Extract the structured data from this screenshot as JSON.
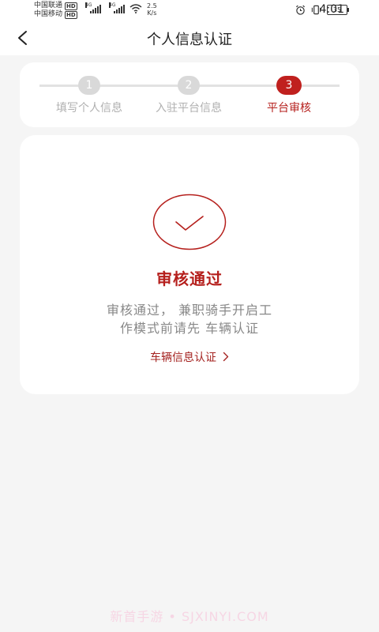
{
  "status_bar": {
    "carrier1": "中国联通",
    "carrier2": "中国移动",
    "hd1": "HD",
    "hd2": "HD",
    "net1": "4G",
    "net2": "4G",
    "speed_value": "2.5",
    "speed_unit": "K/s",
    "battery": "35",
    "time": "4:01",
    "icons": [
      "signal-icon",
      "wifi-icon",
      "alarm-icon",
      "vibrate-icon",
      "battery-icon"
    ]
  },
  "header": {
    "title": "个人信息认证",
    "back_icon": "chevron-left-icon"
  },
  "steps": [
    {
      "number": "1",
      "label": "填写个人信息",
      "active": false
    },
    {
      "number": "2",
      "label": "入驻平台信息",
      "active": false
    },
    {
      "number": "3",
      "label": "平台审核",
      "active": true
    }
  ],
  "result": {
    "icon": "check-circle-icon",
    "title": "审核通过",
    "desc_line1": "审核通过， 兼职骑手开启工",
    "desc_line2": "作模式前请先 车辆认证",
    "link_label": "车辆信息认证",
    "link_icon": "chevron-right-icon"
  },
  "watermark": "新首手游 • SJXINYI.COM",
  "colors": {
    "accent": "#b51f1c",
    "inactive_step": "#d9d9d9",
    "background": "#f5f5f5"
  }
}
